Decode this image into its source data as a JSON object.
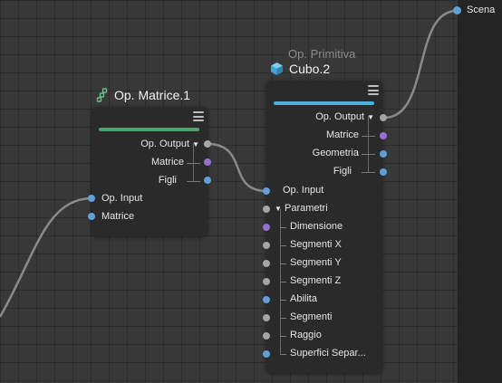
{
  "scene": {
    "label": "Scena"
  },
  "matrix_node": {
    "title": "Op. Matrice.1",
    "accent": "#4fa16f",
    "outputs": [
      "Op. Output",
      "Matrice",
      "Figli"
    ],
    "inputs": [
      "Op. Input",
      "Matrice"
    ]
  },
  "cube_node": {
    "subtitle": "Op. Primitiva",
    "title": "Cubo.2",
    "accent": "#4db0d8",
    "outputs": [
      "Op. Output",
      "Matrice",
      "Geometria",
      "Figli"
    ],
    "input": "Op. Input",
    "group": "Parametri",
    "params": [
      "Dimensione",
      "Segmenti X",
      "Segmenti Y",
      "Segmenti Z",
      "Abilita",
      "Segmenti",
      "Raggio",
      "Superfici Separ..."
    ]
  },
  "colors": {
    "canvas": "#383838",
    "node": "#2a2a2a",
    "port_blue": "#5fa0d8",
    "port_purple": "#9a6fd2",
    "port_gray": "#a5a5a5"
  },
  "icons": {
    "matrix": "matrix-cloner-icon",
    "cube": "cube-icon",
    "menu": "hamburger-menu-icon"
  }
}
